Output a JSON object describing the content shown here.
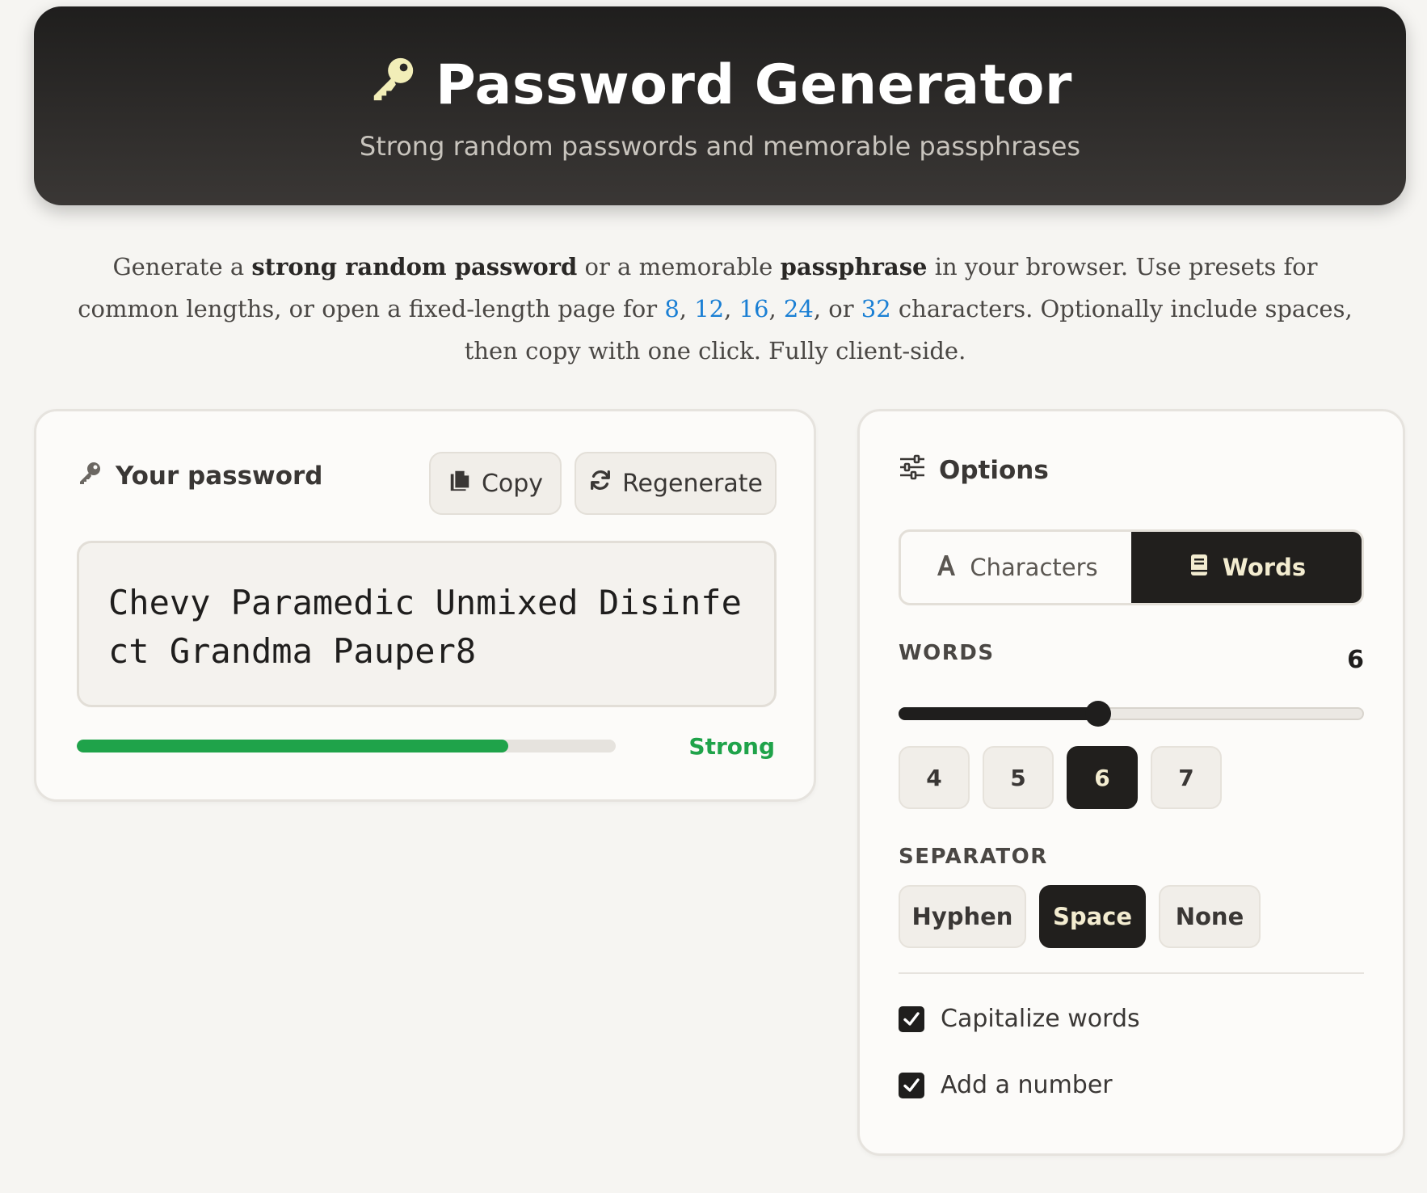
{
  "header": {
    "title": "Password Generator",
    "subtitle": "Strong random passwords and memorable passphrases"
  },
  "intro": {
    "t1": "Generate a ",
    "b1": "strong random password",
    "t2": " or a memorable ",
    "b2": "passphrase",
    "t3": " in your browser. Use presets for common lengths, or open a fixed-length page for ",
    "link_8": "8",
    "c1": ", ",
    "link_12": "12",
    "c2": ", ",
    "link_16": "16",
    "c3": ", ",
    "link_24": "24",
    "c4": ", or ",
    "link_32": "32",
    "t4": " characters. Optionally include spaces, then copy with one click. Fully client-side."
  },
  "password_card": {
    "label": "Your password",
    "copy_label": "Copy",
    "regenerate_label": "Regenerate",
    "password": "Chevy Paramedic Unmixed Disinfect Grandma Pauper8",
    "strength_label": "Strong",
    "strength_fraction": 0.8,
    "strength_color": "#1fa34a"
  },
  "options": {
    "title": "Options",
    "mode": {
      "characters_label": "Characters",
      "words_label": "Words",
      "selected": "Words"
    },
    "words": {
      "label": "WORDS",
      "value": "6",
      "min": 3,
      "max": 10,
      "presets": [
        "4",
        "5",
        "6",
        "7"
      ],
      "selected": "6"
    },
    "separator": {
      "label": "SEPARATOR",
      "options": [
        "Hyphen",
        "Space",
        "None"
      ],
      "selected": "Space"
    },
    "capitalize_label": "Capitalize words",
    "capitalize_checked": true,
    "add_number_label": "Add a number",
    "add_number_checked": true
  },
  "colors": {
    "accent_dark": "#211f1d",
    "accent_text": "#f3ecd0",
    "link": "#1a7fd4",
    "key_icon": "#f2eeb8"
  }
}
